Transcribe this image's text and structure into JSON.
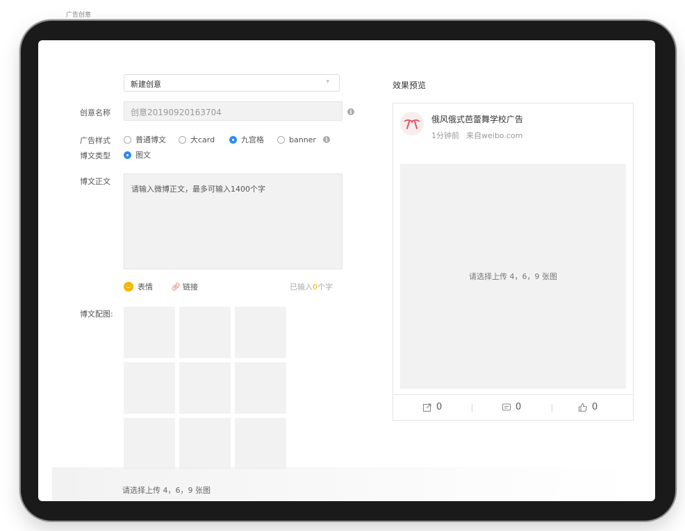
{
  "corner_text": "广告创意",
  "form": {
    "creative_select": "新建创意",
    "name_label": "创意名称",
    "name_value": "创意20190920163704",
    "style_label": "广告样式",
    "style_options": [
      "普通博文",
      "大card",
      "九宫格",
      "banner"
    ],
    "style_selected": "九宫格",
    "post_type_label": "博文类型",
    "post_type_option": "图文",
    "body_label": "博文正文",
    "body_placeholder": "请输入微博正文，最多可输入1400个字",
    "emoji_label": "表情",
    "link_label": "链接",
    "count_prefix": "已输入",
    "count_value": "0",
    "count_suffix": "个字",
    "images_label": "博文配图:",
    "images_hint": "请选择上传 4，6，9 张图"
  },
  "preview": {
    "title": "效果预览",
    "account_name": "俄风俄式芭蕾舞学校广告",
    "time": "1分钟前",
    "source": "来自weibo.com",
    "image_hint": "请选择上传 4，6，9 张图",
    "reposts": "0",
    "comments": "0",
    "likes": "0"
  },
  "colors": {
    "accent": "#2d8cf0",
    "count_highlight": "#f7b500",
    "emoji": "#f7b500",
    "link_icon": "#e05a3b",
    "avatar_logo": "#e84a5f"
  }
}
